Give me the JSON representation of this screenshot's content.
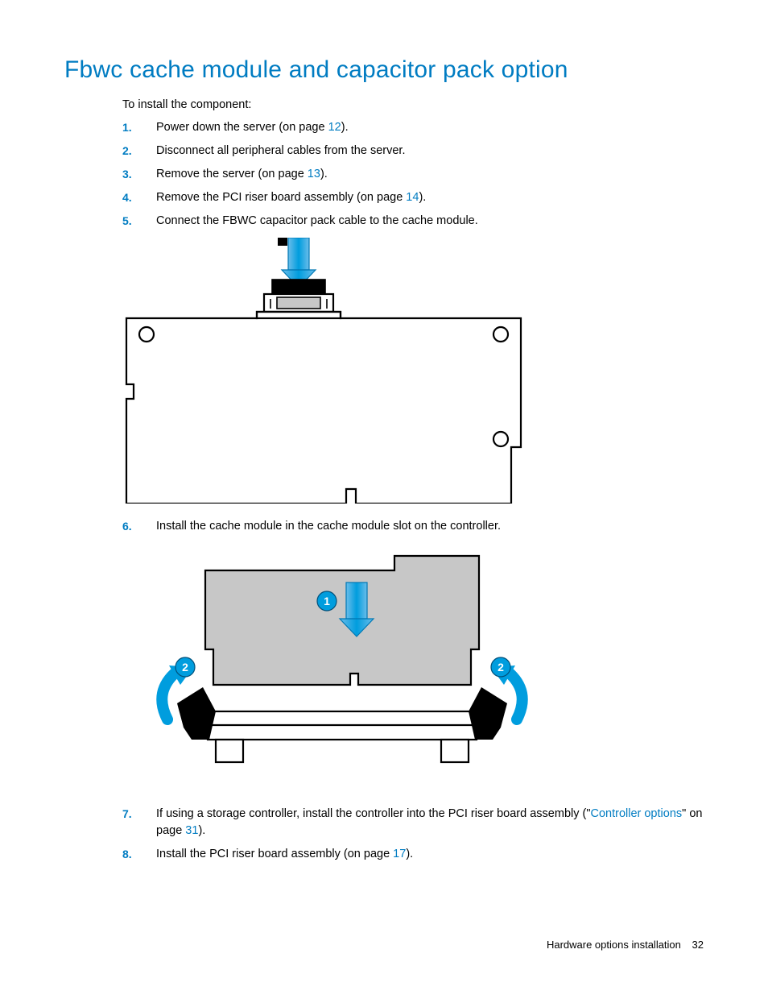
{
  "heading": "Fbwc cache module and capacitor pack option",
  "intro": "To install the component:",
  "steps": [
    {
      "num": "1.",
      "pre": "Power down the server (on page ",
      "link": "12",
      "post": ")."
    },
    {
      "num": "2.",
      "pre": "Disconnect all peripheral cables from the server.",
      "link": "",
      "post": ""
    },
    {
      "num": "3.",
      "pre": "Remove the server (on page ",
      "link": "13",
      "post": ")."
    },
    {
      "num": "4.",
      "pre": "Remove the PCI riser board assembly (on page ",
      "link": "14",
      "post": ")."
    },
    {
      "num": "5.",
      "pre": "Connect the FBWC capacitor pack cable to the cache module.",
      "link": "",
      "post": ""
    },
    {
      "num": "6.",
      "pre": "Install the cache module in the cache module slot on the controller.",
      "link": "",
      "post": ""
    },
    {
      "num": "7.",
      "pre": "If using a storage controller, install the controller into the PCI riser board assembly (\"",
      "link": "Controller options",
      "post": "\" on page ",
      "link2": "31",
      "post2": ")."
    },
    {
      "num": "8.",
      "pre": "Install the PCI riser board assembly (on page ",
      "link": "17",
      "post": ")."
    }
  ],
  "footer": {
    "section": "Hardware options installation",
    "page": "32"
  }
}
